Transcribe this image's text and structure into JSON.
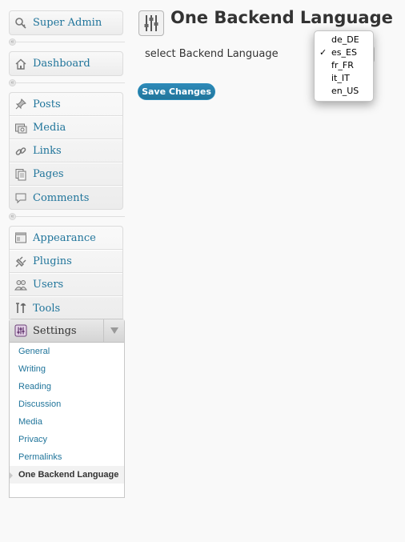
{
  "sidebar": {
    "super_admin": "Super Admin",
    "dashboard": "Dashboard",
    "content_items": [
      {
        "label": "Posts",
        "icon": "pushpin-icon"
      },
      {
        "label": "Media",
        "icon": "camera-icon"
      },
      {
        "label": "Links",
        "icon": "link-icon"
      },
      {
        "label": "Pages",
        "icon": "pages-icon"
      },
      {
        "label": "Comments",
        "icon": "comment-icon"
      }
    ],
    "admin_items": [
      {
        "label": "Appearance",
        "icon": "appearance-icon"
      },
      {
        "label": "Plugins",
        "icon": "plugin-icon"
      },
      {
        "label": "Users",
        "icon": "users-icon"
      },
      {
        "label": "Tools",
        "icon": "tools-icon"
      }
    ],
    "settings": {
      "label": "Settings",
      "submenu": [
        "General",
        "Writing",
        "Reading",
        "Discussion",
        "Media",
        "Privacy",
        "Permalinks"
      ],
      "current": "One Backend Language"
    },
    "collapse_glyph": "«"
  },
  "main": {
    "title": "One Backend Language",
    "field_label": "select Backend Language",
    "language_options": [
      "de_DE",
      "es_ES",
      "fr_FR",
      "it_IT",
      "en_US"
    ],
    "selected_option": "es_ES",
    "check_glyph": "✓",
    "save_label": "Save Changes"
  },
  "colors": {
    "link": "#21759b",
    "button": "#21759b",
    "background": "#f9f9f9"
  }
}
